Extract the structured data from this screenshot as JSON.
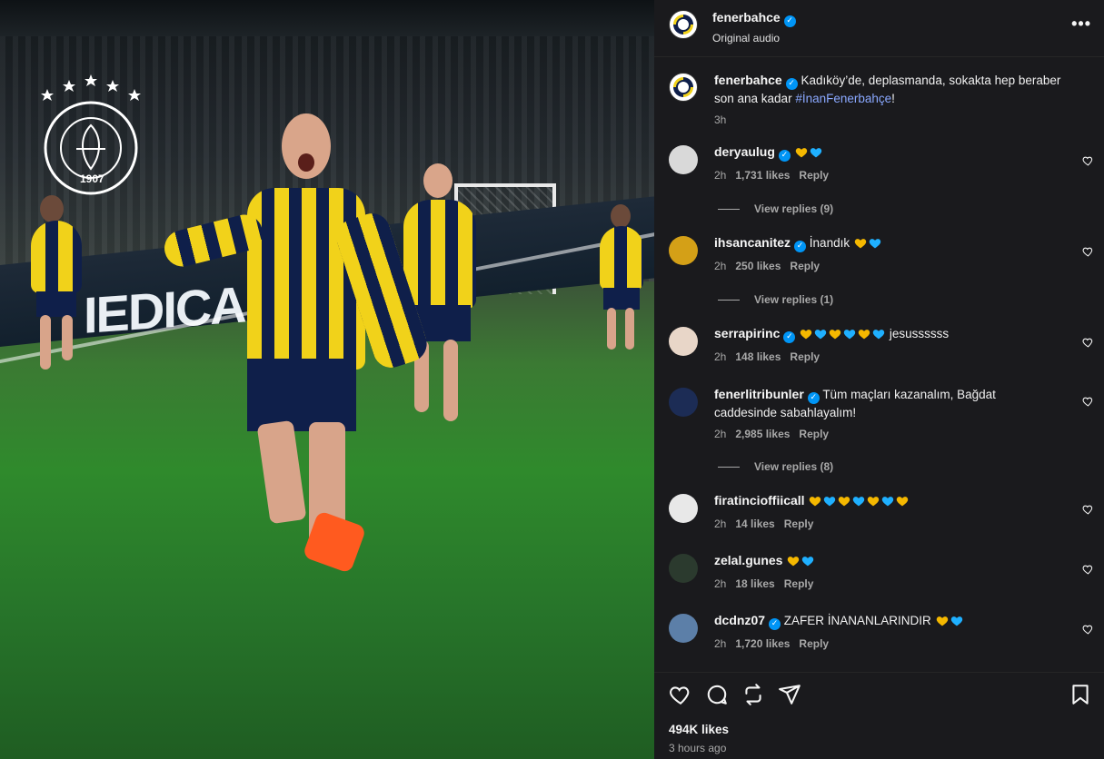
{
  "header": {
    "username": "fenerbahce",
    "verified": true,
    "subtitle": "Original audio",
    "more_icon": "more-horizontal-icon"
  },
  "caption": {
    "username": "fenerbahce",
    "verified": true,
    "text_part1": "Kadıköy’de, deplasmanda, sokakta hep beraber son ana kadar ",
    "hashtag": "#İnanFenerbahçe",
    "text_part2": "!",
    "time": "3h"
  },
  "media": {
    "ad_text": "IEDICANA",
    "club_logo_text": "FENERBAHÇE SPOR KULÜBÜ",
    "club_year": "1907"
  },
  "comments": [
    {
      "username": "deryaulug",
      "verified": true,
      "text": "",
      "hearts": [
        "yellow",
        "blue"
      ],
      "time": "2h",
      "likes": "1,731 likes",
      "reply": "Reply",
      "view_replies": "View replies (9)"
    },
    {
      "username": "ihsancanitez",
      "verified": true,
      "text": "İnandık",
      "hearts": [
        "yellow",
        "blue"
      ],
      "time": "2h",
      "likes": "250 likes",
      "reply": "Reply",
      "view_replies": "View replies (1)"
    },
    {
      "username": "serrapirinc",
      "verified": true,
      "text": "jesussssss",
      "hearts": [
        "yellow",
        "blue",
        "yellow",
        "blue",
        "yellow",
        "blue"
      ],
      "time": "2h",
      "likes": "148 likes",
      "reply": "Reply",
      "view_replies": ""
    },
    {
      "username": "fenerlitribunler",
      "verified": true,
      "text": "Tüm maçları kazanalım, Bağdat caddesinde sabahlayalım!",
      "hearts": [],
      "time": "2h",
      "likes": "2,985 likes",
      "reply": "Reply",
      "view_replies": "View replies (8)"
    },
    {
      "username": "firatincioffiicall",
      "verified": false,
      "text": "",
      "hearts": [
        "yellow",
        "blue",
        "yellow",
        "blue",
        "yellow",
        "blue",
        "yellow"
      ],
      "time": "2h",
      "likes": "14 likes",
      "reply": "Reply",
      "view_replies": ""
    },
    {
      "username": "zelal.gunes",
      "verified": false,
      "text": "",
      "hearts": [
        "yellow",
        "blue"
      ],
      "time": "2h",
      "likes": "18 likes",
      "reply": "Reply",
      "view_replies": ""
    },
    {
      "username": "dcdnz07",
      "verified": true,
      "text": "ZAFER İNANANLARINDIR",
      "hearts": [
        "yellow",
        "blue"
      ],
      "time": "2h",
      "likes": "1,720 likes",
      "reply": "Reply",
      "view_replies": ""
    }
  ],
  "footer": {
    "likes": "494K likes",
    "posted": "3 hours ago",
    "icons": [
      "heart-icon",
      "comment-icon",
      "repost-icon",
      "share-icon",
      "bookmark-icon"
    ]
  },
  "colors": {
    "panel_bg": "#1a1a1d",
    "verified_blue": "#0095f6",
    "heart_yellow": "#f5b800",
    "heart_blue": "#1fb0ff",
    "hashtag": "#8aa8ff"
  }
}
